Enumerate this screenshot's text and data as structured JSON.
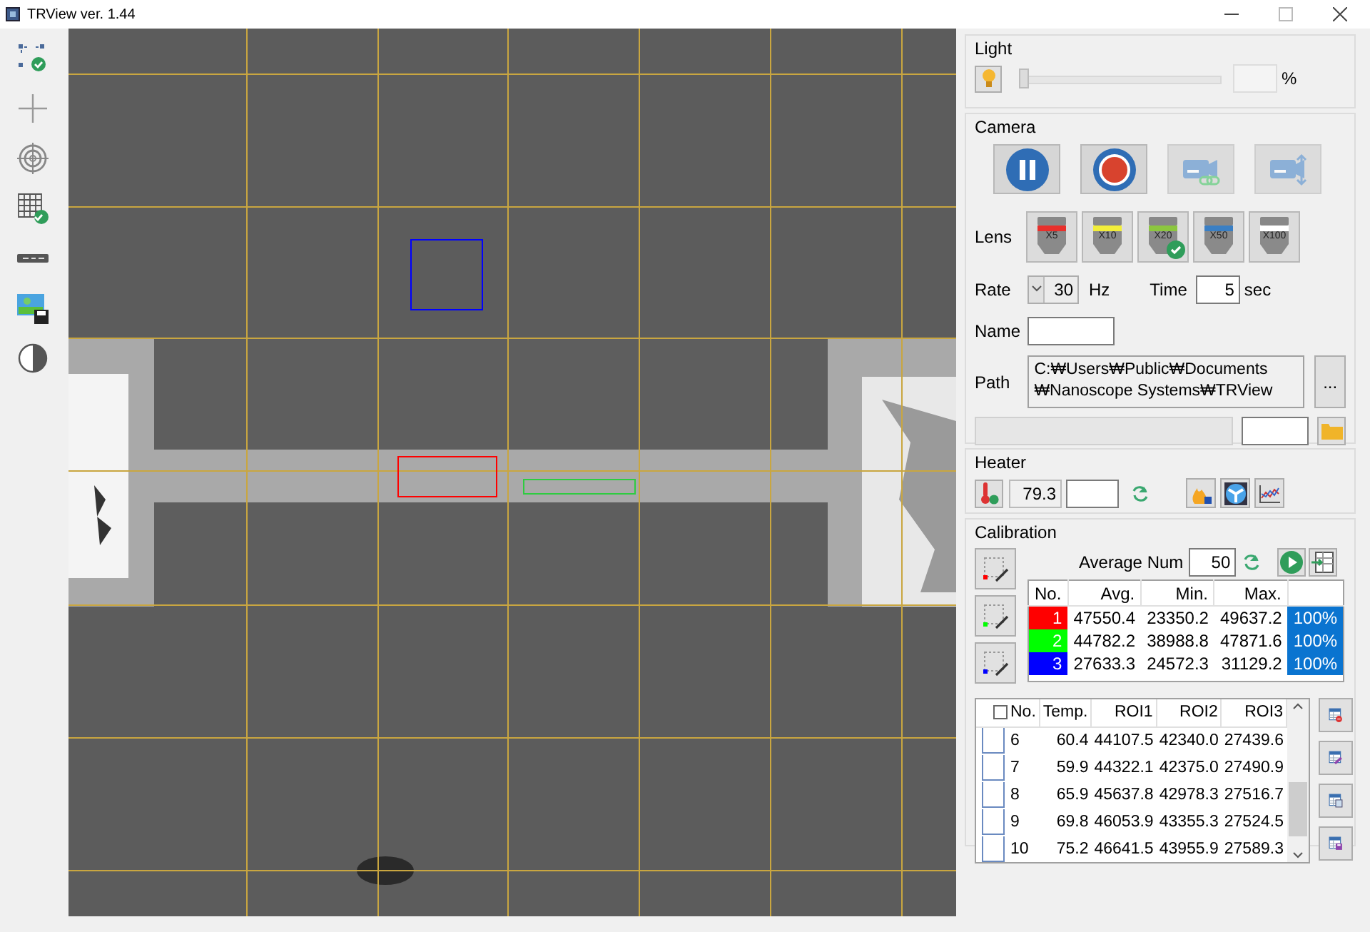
{
  "window": {
    "title": "TRView ver. 1.44"
  },
  "light": {
    "title": "Light",
    "level": 0,
    "unit": "%"
  },
  "camera": {
    "title": "Camera",
    "buttons": [
      {
        "kind": "pause",
        "disabled": false
      },
      {
        "kind": "record",
        "disabled": false
      },
      {
        "kind": "link",
        "disabled": true
      },
      {
        "kind": "transfer",
        "disabled": true
      }
    ],
    "lens_label": "Lens",
    "lenses": [
      {
        "label": "X5",
        "color": "#e8302c",
        "selected": false
      },
      {
        "label": "X10",
        "color": "#f2ee3a",
        "selected": false
      },
      {
        "label": "X20",
        "color": "#8cc63f",
        "selected": true
      },
      {
        "label": "X50",
        "color": "#3a7fc4",
        "selected": false
      },
      {
        "label": "X100",
        "color": "#ffffff",
        "selected": false
      }
    ],
    "rate_label": "Rate",
    "rate": "30",
    "rate_unit": "Hz",
    "time_label": "Time",
    "time": "5",
    "time_unit": "sec",
    "name_label": "Name",
    "path_label": "Path",
    "path": "C:₩Users₩Public₩Documents\n₩Nanoscope Systems₩TRView",
    "browse": "...",
    "progress": {
      "level": 0
    }
  },
  "heater": {
    "title": "Heater",
    "temperature": "79.3"
  },
  "calibration": {
    "title": "Calibration",
    "average_label": "Average Num",
    "average": "50",
    "columns": [
      "No.",
      "Avg.",
      "Min.",
      "Max."
    ],
    "rois": [
      {
        "no": "1",
        "color": "#ff0000",
        "avg": "47550.4",
        "min": "23350.2",
        "max": "49637.2",
        "percent": "100%"
      },
      {
        "no": "2",
        "color": "#00ff00",
        "avg": "44782.2",
        "min": "38988.8",
        "max": "47871.6",
        "percent": "100%"
      },
      {
        "no": "3",
        "color": "#0000ff",
        "avg": "27633.3",
        "min": "24572.3",
        "max": "31129.2",
        "percent": "100%"
      }
    ]
  },
  "log": {
    "header_checked": false,
    "columns": [
      "No.",
      "Temp.",
      "ROI1",
      "ROI2",
      "ROI3"
    ],
    "rows": [
      {
        "checked": false,
        "no": "6",
        "temp": "60.4",
        "roi1": "44107.5",
        "roi2": "42340.0",
        "roi3": "27439.6"
      },
      {
        "checked": false,
        "no": "7",
        "temp": "59.9",
        "roi1": "44322.1",
        "roi2": "42375.0",
        "roi3": "27490.9"
      },
      {
        "checked": false,
        "no": "8",
        "temp": "65.9",
        "roi1": "45637.8",
        "roi2": "42978.3",
        "roi3": "27516.7"
      },
      {
        "checked": false,
        "no": "9",
        "temp": "69.8",
        "roi1": "46053.9",
        "roi2": "43355.3",
        "roi3": "27524.5"
      },
      {
        "checked": false,
        "no": "10",
        "temp": "75.2",
        "roi1": "46641.5",
        "roi2": "43955.9",
        "roi3": "27589.3"
      }
    ]
  }
}
